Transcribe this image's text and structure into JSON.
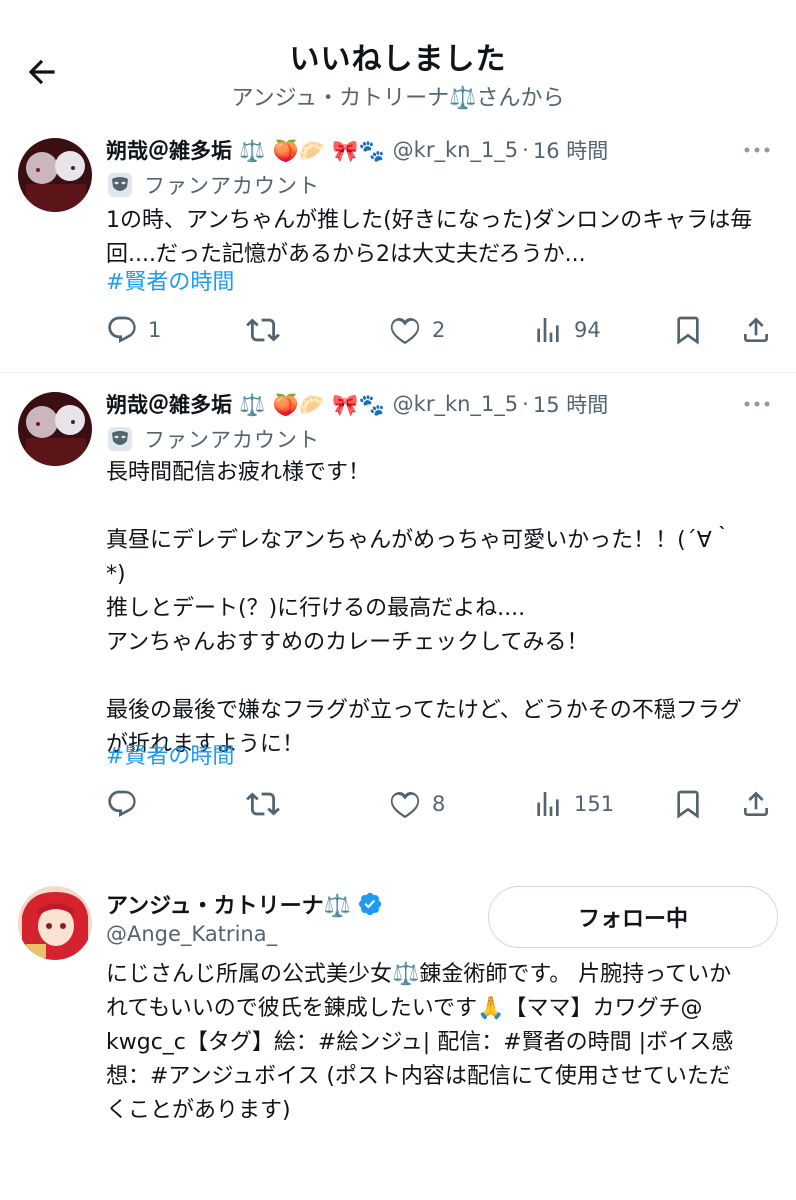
{
  "header": {
    "title": "いいねしました",
    "subtitle": "アンジュ・カトリーナ⚖️さんから"
  },
  "tweets": [
    {
      "name": "朔哉＠雑多垢 ⚖️ 🍑🥟 🎀🐾",
      "handle": "@kr_kn_1_5",
      "time": "16 時間",
      "badge_label": "ファンアカウント",
      "body": "1の時、アンちゃんが推した(好きになった)ダンロンのキャラは毎\n回....だった記憶があるから2は大丈夫だろうか...",
      "hashtag": "#賢者の時間",
      "replies": "1",
      "retweets": "",
      "likes": "2",
      "views": "94"
    },
    {
      "name": "朔哉＠雑多垢 ⚖️ 🍑🥟 🎀🐾",
      "handle": "@kr_kn_1_5",
      "time": "15 時間",
      "badge_label": "ファンアカウント",
      "body": "長時間配信お疲れ様です！\n\n真昼にデレデレなアンちゃんがめっちゃ可愛いかった！！(´∀｀\n*)\n推しとデート(？)に行けるの最高だよね....\nアンちゃんおすすめのカレーチェックしてみる！\n\n最後の最後で嫌なフラグが立ってたけど、どうかその不穏フラグ\nが折れますように！",
      "hashtag": "#賢者の時間",
      "replies": "",
      "retweets": "",
      "likes": "8",
      "views": "151"
    }
  ],
  "profile": {
    "name": "アンジュ・カトリーナ⚖️",
    "handle": "@Ange_Katrina_",
    "follow_label": "フォロー中",
    "bio": "にじさんじ所属の公式美少女⚖️錬金術師です。 片腕持っていか\nれてもいいので彼氏を錬成したいです🙏【ママ】カワグチ@\nkwgc_c【タグ】絵：#絵ンジュ| 配信：#賢者の時間 |ボイス感\n想：#アンジュボイス (ポスト内容は配信にて使用させていただ\nくことがあります)"
  },
  "colors": {
    "accent": "#1d9bf0",
    "secondary_text": "#536471",
    "verified": "#1d9bf0"
  },
  "icons": [
    "back-arrow-icon",
    "more-icon",
    "fan-mask-icon",
    "reply-icon",
    "retweet-icon",
    "like-icon",
    "views-icon",
    "bookmark-icon",
    "share-icon",
    "verified-icon"
  ]
}
